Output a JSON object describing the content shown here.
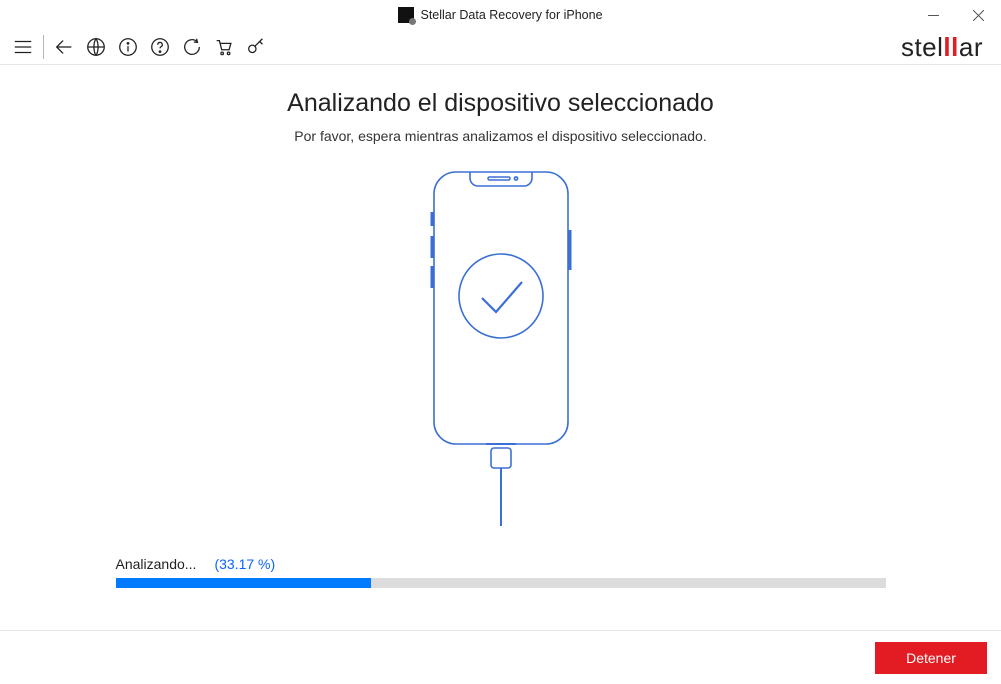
{
  "titlebar": {
    "title": "Stellar Data Recovery for iPhone"
  },
  "brand": {
    "name": "stellar",
    "accent_letters": "ll",
    "accent_color": "#e31c23"
  },
  "main": {
    "heading": "Analizando el dispositivo seleccionado",
    "subheading": "Por favor, espera mientras analizamos el dispositivo seleccionado."
  },
  "progress": {
    "status_label": "Analizando...",
    "percent_label": "(33.17 %)",
    "percent_value": 33.17
  },
  "footer": {
    "stop_label": "Detener"
  },
  "toolbar_icons": {
    "menu": "menu-icon",
    "back": "back-arrow-icon",
    "globe": "globe-icon",
    "info": "info-icon",
    "help": "help-icon",
    "refresh": "refresh-icon",
    "cart": "cart-icon",
    "key": "key-icon"
  }
}
